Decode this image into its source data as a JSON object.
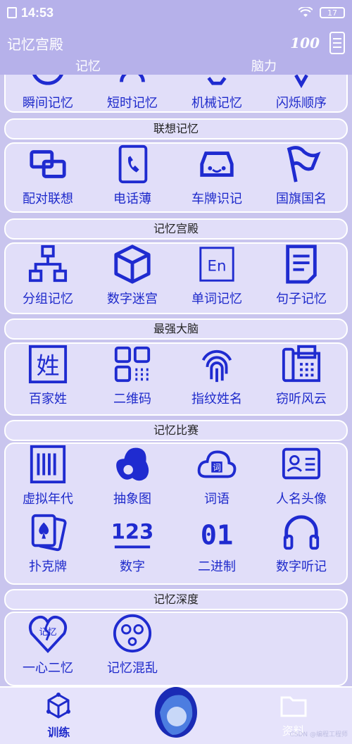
{
  "status": {
    "time": "14:53",
    "battery": "17"
  },
  "header": {
    "title": "记忆宫殿",
    "score_icon": "100"
  },
  "tabs": [
    {
      "label": "记忆"
    },
    {
      "label": "脑力"
    }
  ],
  "sections": [
    {
      "items": [
        "瞬间记忆",
        "短时记忆",
        "机械记忆",
        "闪烁顺序"
      ]
    },
    {
      "title": "联想记忆",
      "items": [
        "配对联想",
        "电话薄",
        "车牌识记",
        "国旗国名"
      ]
    },
    {
      "title": "记忆宫殿",
      "items": [
        "分组记忆",
        "数字迷宫",
        "单词记忆",
        "句子记忆"
      ]
    },
    {
      "title": "最强大脑",
      "items": [
        "百家姓",
        "二维码",
        "指纹姓名",
        "窃听风云"
      ]
    },
    {
      "title": "记忆比赛",
      "items": [
        "虚拟年代",
        "抽象图",
        "词语",
        "人名头像",
        "扑克牌",
        "数字",
        "二进制",
        "数字听记"
      ]
    },
    {
      "title": "记忆深度",
      "items": [
        "一心二忆",
        "记忆混乱"
      ]
    }
  ],
  "icon_texts": {
    "surname": "姓",
    "word": "词",
    "en": "En",
    "num123": "123",
    "binary": "01",
    "heart": "记忆"
  },
  "bottom_nav": {
    "train": "训练",
    "data": "资料"
  },
  "watermark": "CSDN @编程工程师",
  "colors": {
    "accent": "#1f2bd0",
    "header": "#b6b1ea",
    "background": "#c9c5ee",
    "card": "#e1def9"
  }
}
